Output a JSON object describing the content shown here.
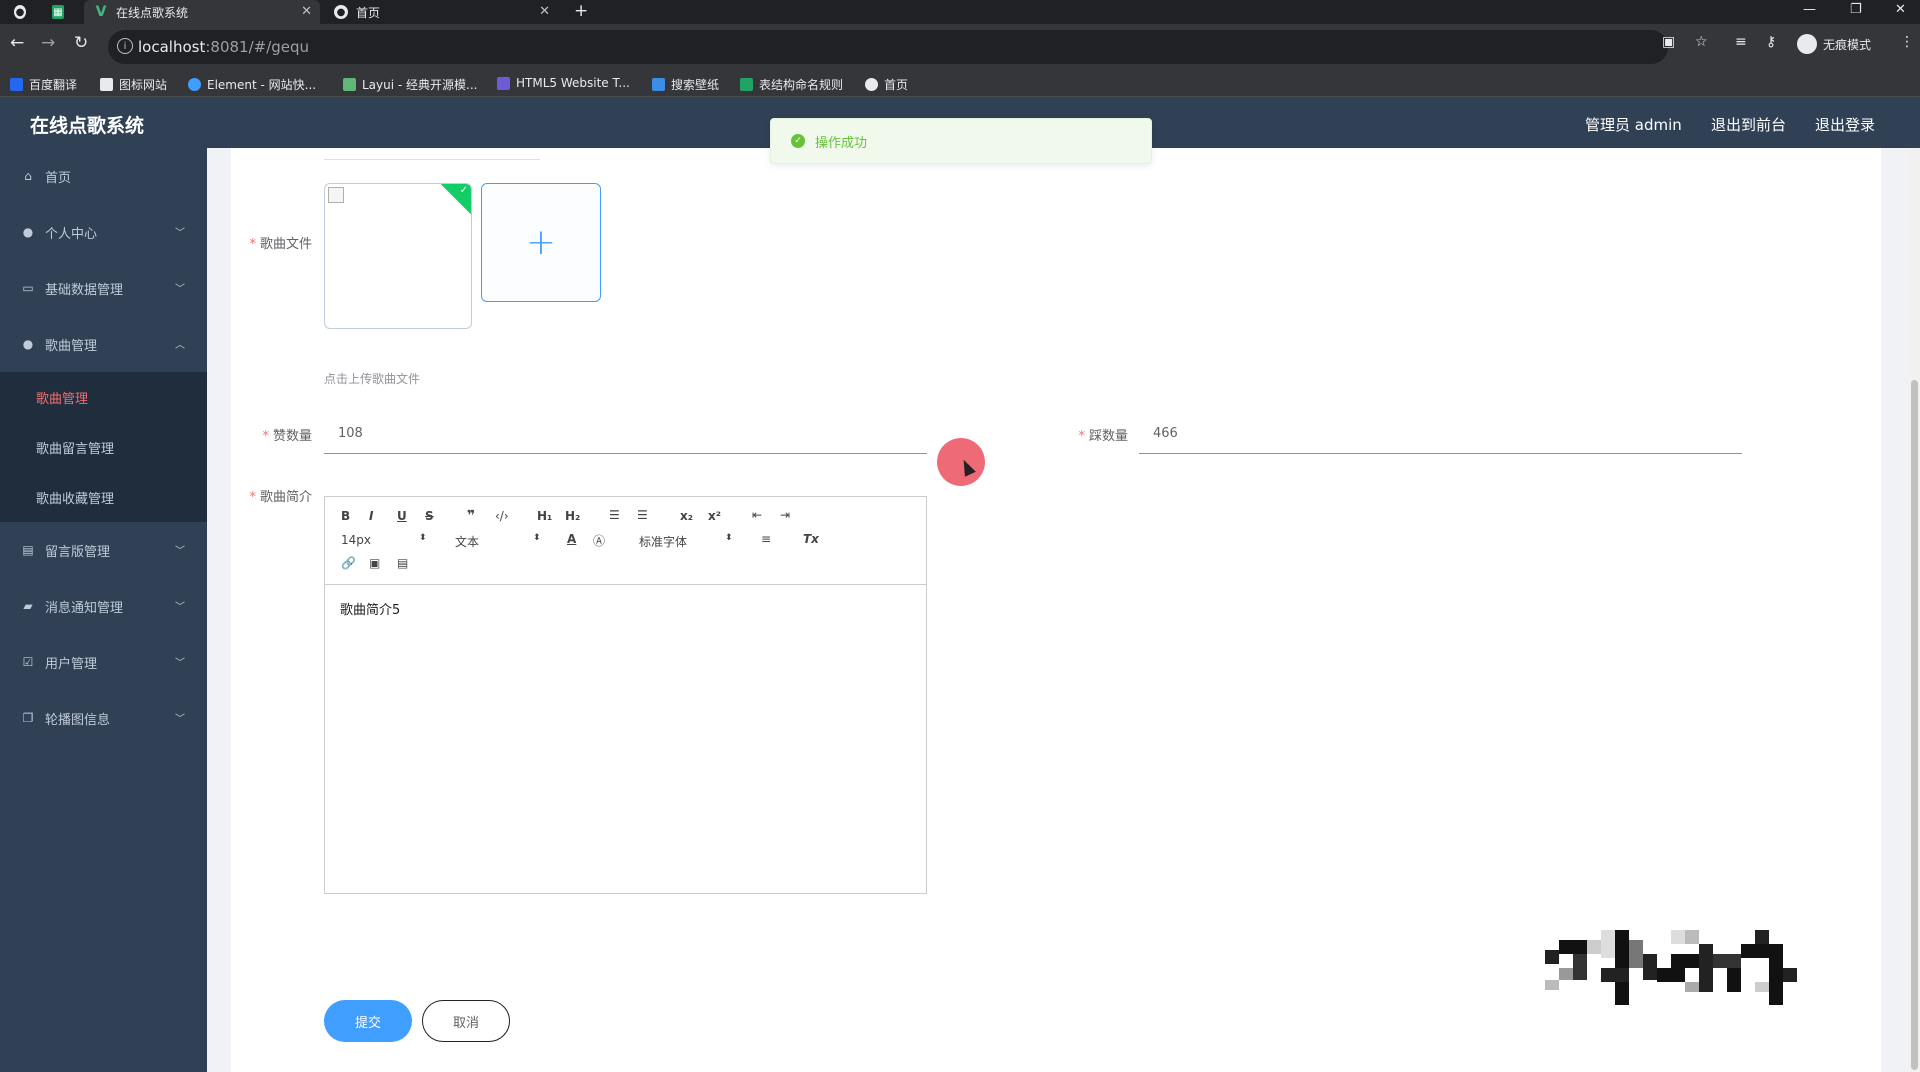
{
  "browser": {
    "tabs": [
      {
        "title": "在线点歌系统",
        "active": true
      },
      {
        "title": "首页",
        "active": false
      }
    ],
    "url_host": "localhost",
    "url_path": ":8081/#/gequ",
    "incognito_label": "无痕模式",
    "bookmarks": [
      "百度翻译",
      "图标网站",
      "Element - 网站快...",
      "Layui - 经典开源模...",
      "HTML5 Website T...",
      "搜索壁纸",
      "表结构命名规则",
      "首页"
    ]
  },
  "header": {
    "title": "在线点歌系统",
    "admin_label": "管理员 admin",
    "to_front_label": "退出到前台",
    "logout_label": "退出登录"
  },
  "sidebar": {
    "items": [
      {
        "label": "首页"
      },
      {
        "label": "个人中心"
      },
      {
        "label": "基础数据管理"
      },
      {
        "label": "歌曲管理"
      },
      {
        "label": "留言版管理"
      },
      {
        "label": "消息通知管理"
      },
      {
        "label": "用户管理"
      },
      {
        "label": "轮播图信息"
      }
    ],
    "subitems": [
      {
        "label": "歌曲管理",
        "active": true
      },
      {
        "label": "歌曲留言管理",
        "active": false
      },
      {
        "label": "歌曲收藏管理",
        "active": false
      }
    ]
  },
  "form": {
    "song_file_label": "歌曲文件",
    "upload_tip": "点击上传歌曲文件",
    "likes_label": "赞数量",
    "likes_value": "108",
    "dislikes_label": "踩数量",
    "dislikes_value": "466",
    "intro_label": "歌曲简介",
    "editor": {
      "font_size": "14px",
      "block_format": "文本",
      "font_family": "标准字体",
      "content": "歌曲简介5"
    },
    "submit_label": "提交",
    "cancel_label": "取消"
  },
  "toast": {
    "message": "操作成功"
  },
  "colors": {
    "sidebar_bg": "#304156",
    "primary": "#409eff",
    "success": "#67c23a",
    "active_menu": "#f56c6c"
  }
}
